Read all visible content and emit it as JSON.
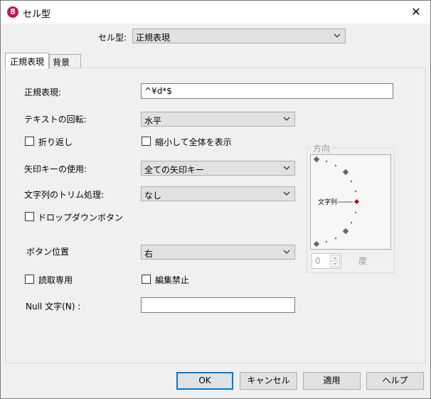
{
  "window": {
    "title": "セル型",
    "app_icon_letter": "8",
    "close_glyph": "✕"
  },
  "celltype": {
    "label": "セル型:",
    "value": "正規表現"
  },
  "tabs": [
    {
      "label": "正規表現"
    },
    {
      "label": "背景"
    }
  ],
  "fields": {
    "regex": {
      "label": "正規表現:",
      "value": "^¥d*$"
    },
    "rotation": {
      "label": "テキストの回転:",
      "value": "水平"
    },
    "wrap": {
      "label": "折り返し",
      "checked": false
    },
    "shrink": {
      "label": "縮小して全体を表示",
      "checked": false
    },
    "arrow_keys": {
      "label": "矢印キーの使用:",
      "value": "全ての矢印キー"
    },
    "trim": {
      "label": "文字列のトリム処理:",
      "value": "なし"
    },
    "dropdown_button": {
      "label": "ドロップダウンボタン",
      "checked": false
    },
    "button_position": {
      "label": "ボタン位置",
      "value": "右"
    },
    "readonly": {
      "label": "読取専用",
      "checked": false
    },
    "edit_lock": {
      "label": "編集禁止",
      "checked": false
    },
    "null_text": {
      "label": "Null 文字(N) :",
      "value": ""
    }
  },
  "orientation": {
    "group_label": "方向",
    "dial_label": "文字列",
    "degrees_value": "0",
    "degrees_unit": "度",
    "accent_color": "#c00000"
  },
  "buttons": {
    "ok": "OK",
    "cancel": "キャンセル",
    "apply": "適用",
    "help": "ヘルプ"
  }
}
